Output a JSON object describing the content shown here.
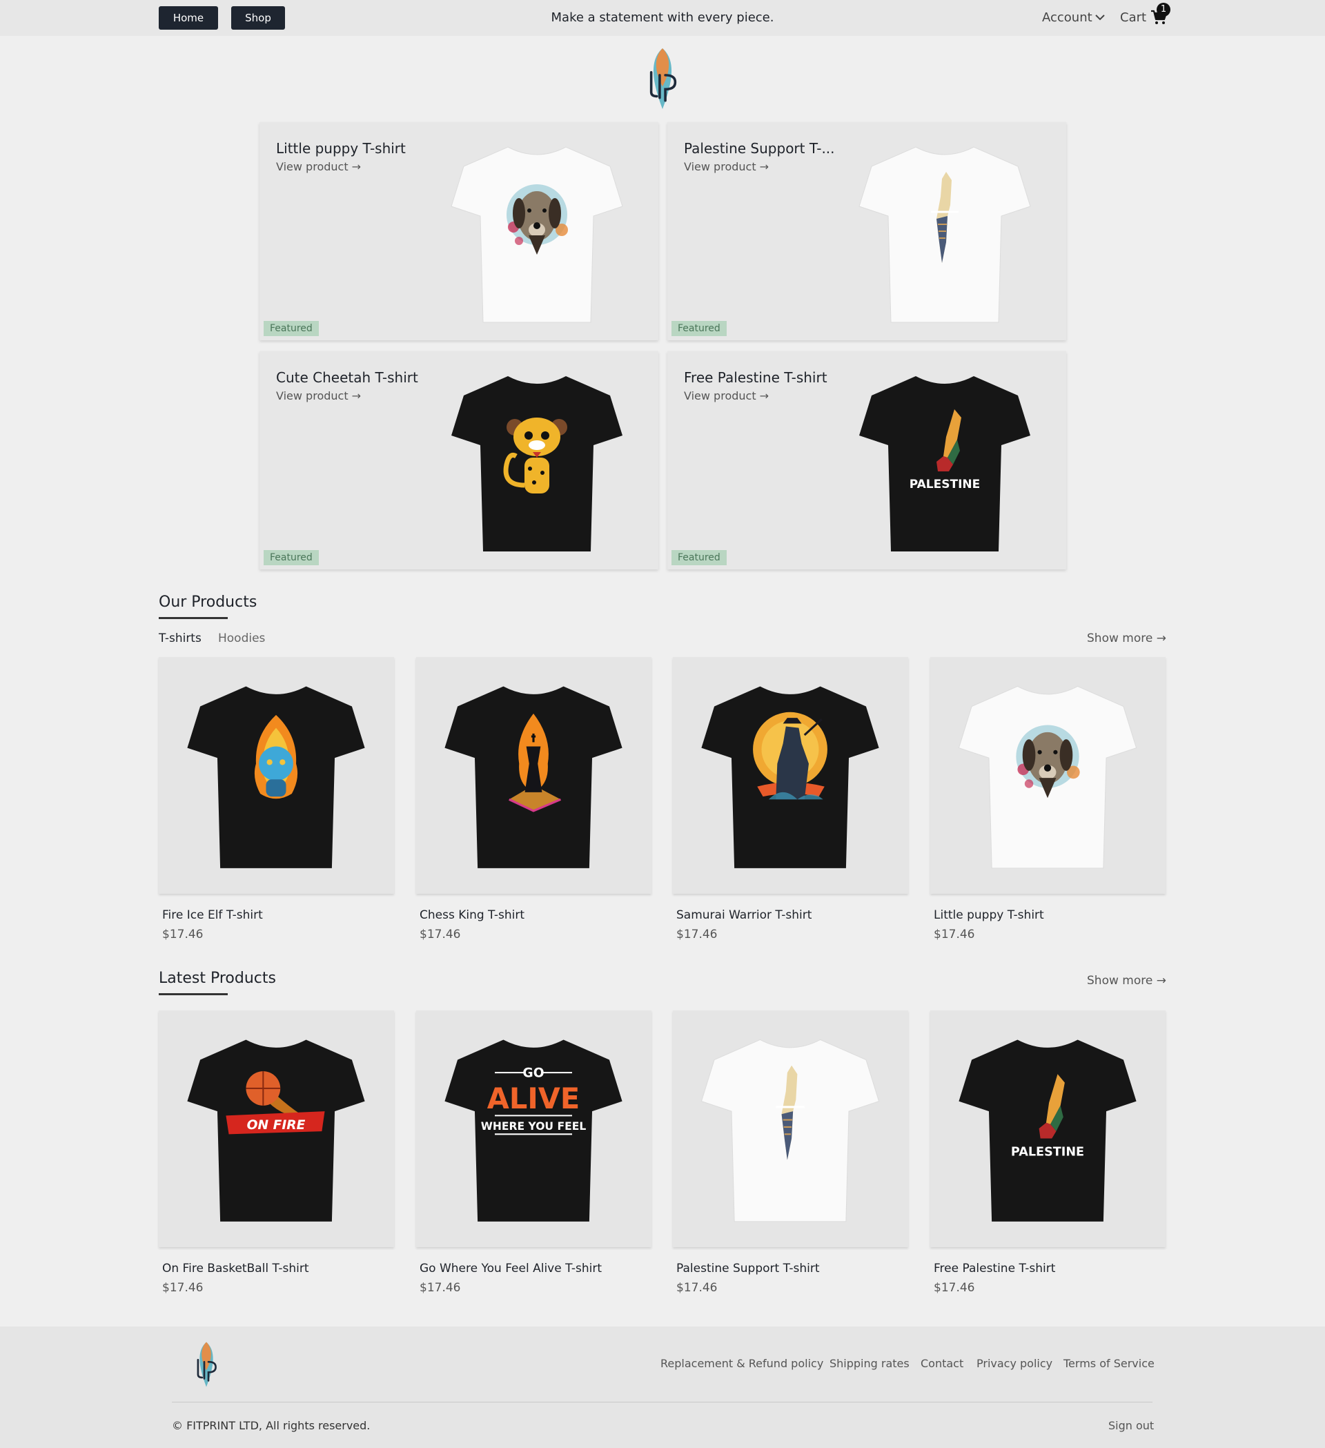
{
  "nav": {
    "home_label": "Home",
    "shop_label": "Shop",
    "tagline": "Make a statement with every piece.",
    "account_label": "Account",
    "cart_label": "Cart",
    "cart_count": "1"
  },
  "featured": {
    "view_label": "View product →",
    "badge_label": "Featured",
    "items": [
      {
        "title": "Little puppy T-shirt",
        "shirt_color": "white",
        "design": "dog-icon"
      },
      {
        "title": "Palestine Support T-...",
        "shirt_color": "white",
        "design": "map-icon"
      },
      {
        "title": "Cute Cheetah T-shirt",
        "shirt_color": "black",
        "design": "cheetah-icon"
      },
      {
        "title": "Free Palestine T-shirt",
        "shirt_color": "black",
        "design": "flag-map-icon",
        "print_text": "PALESTINE"
      }
    ]
  },
  "our_products": {
    "heading": "Our Products",
    "tabs": [
      "T-shirts",
      "Hoodies"
    ],
    "show_more": "Show more →",
    "items": [
      {
        "name": "Fire Ice Elf T-shirt",
        "price": "$17.46",
        "shirt_color": "black",
        "design": "flame-icon"
      },
      {
        "name": "Chess King T-shirt",
        "price": "$17.46",
        "shirt_color": "black",
        "design": "chess-king-icon"
      },
      {
        "name": "Samurai Warrior T-shirt",
        "price": "$17.46",
        "shirt_color": "black",
        "design": "samurai-icon"
      },
      {
        "name": "Little puppy T-shirt",
        "price": "$17.46",
        "shirt_color": "white",
        "design": "dog-icon"
      }
    ]
  },
  "latest_products": {
    "heading": "Latest Products",
    "show_more": "Show more →",
    "items": [
      {
        "name": "On Fire BasketBall T-shirt",
        "price": "$17.46",
        "shirt_color": "black",
        "design": "basketball-icon",
        "print_text": "ON FIRE"
      },
      {
        "name": "Go Where You Feel Alive T-shirt",
        "price": "$17.46",
        "shirt_color": "black",
        "design": "text-print",
        "print_lines": [
          "GO",
          "ALIVE",
          "WHERE YOU FEEL"
        ]
      },
      {
        "name": "Palestine Support T-shirt",
        "price": "$17.46",
        "shirt_color": "white",
        "design": "map-icon"
      },
      {
        "name": "Free Palestine T-shirt",
        "price": "$17.46",
        "shirt_color": "black",
        "design": "flag-map-icon",
        "print_text": "PALESTINE"
      }
    ]
  },
  "footer": {
    "links": [
      "Replacement & Refund policy",
      "Shipping rates",
      "Contact",
      "Privacy policy",
      "Terms of Service"
    ],
    "copyright": "© FITPRINT LTD, All rights reserved.",
    "sign_out": "Sign out"
  },
  "colors": {
    "nav_button": "#1e2530",
    "featured_badge_bg": "#b9d6c2",
    "featured_badge_text": "#4a7659",
    "brand_orange": "#f08a3c",
    "brand_teal": "#3aa6b9"
  }
}
